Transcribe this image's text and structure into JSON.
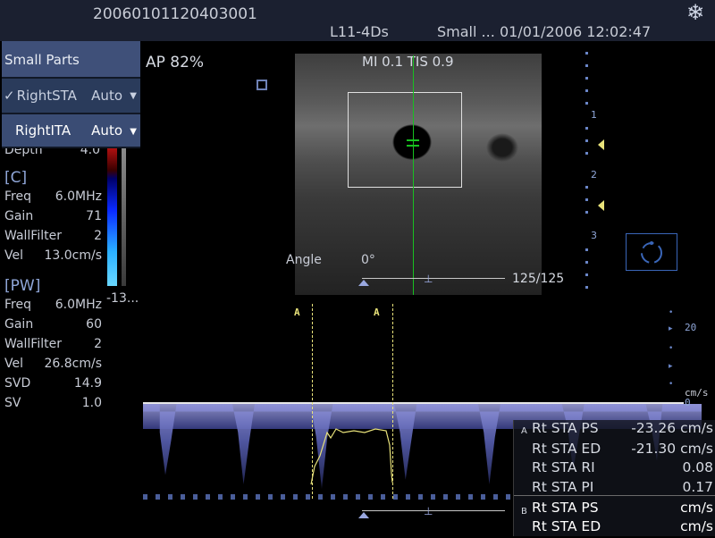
{
  "header": {
    "patient_id": "20060101120403001",
    "probe": "L11-4Ds",
    "preset": "Small ...",
    "datetime": "01/01/2006 12:02:47"
  },
  "menu": {
    "items": [
      {
        "label": "Small Parts",
        "value": "",
        "checked": false
      },
      {
        "label": "RightSTA",
        "value": "Auto",
        "checked": true
      },
      {
        "label": "RightITA",
        "value": "Auto",
        "checked": false
      }
    ]
  },
  "image_info": {
    "ap": "AP  82%",
    "mi_tis": "MI 0.1  TIS 0.9",
    "angle_label": "Angle",
    "angle_value": "0°",
    "frame_counter": "125/125"
  },
  "depth": {
    "label": "Depth",
    "value": "4.0",
    "scale": [
      "1",
      "2",
      "3"
    ]
  },
  "color_params": {
    "title": "[C]",
    "rows": [
      {
        "label": "Freq",
        "value": "6.0MHz"
      },
      {
        "label": "Gain",
        "value": "71"
      },
      {
        "label": "WallFilter",
        "value": "2"
      },
      {
        "label": "Vel",
        "value": "13.0cm/s"
      }
    ],
    "colorbar_min": "-13..."
  },
  "pw_params": {
    "title": "[PW]",
    "rows": [
      {
        "label": "Freq",
        "value": "6.0MHz"
      },
      {
        "label": "Gain",
        "value": "60"
      },
      {
        "label": "WallFilter",
        "value": "2"
      },
      {
        "label": "Vel",
        "value": "26.8cm/s"
      },
      {
        "label": "SVD",
        "value": "14.9"
      },
      {
        "label": "SV",
        "value": "1.0"
      }
    ]
  },
  "doppler": {
    "marker_a1": "A",
    "marker_a2": "A",
    "scale_top": "20",
    "unit": "cm/s",
    "scale_zero": "0"
  },
  "measurements": {
    "group_a_tag": "A",
    "group_b_tag": "B",
    "rows": [
      {
        "label": "Rt STA PS",
        "value": "-23.26 cm/s"
      },
      {
        "label": "Rt STA ED",
        "value": "-21.30 cm/s"
      },
      {
        "label": "Rt STA RI",
        "value": "0.08"
      },
      {
        "label": "Rt STA PI",
        "value": "0.17"
      },
      {
        "label": "Rt STA PS",
        "value": "cm/s"
      },
      {
        "label": "Rt STA ED",
        "value": "cm/s"
      }
    ]
  },
  "colors": {
    "accent_blue": "#8fa6d8",
    "doppler_gate": "#18c020",
    "marker_yellow": "#e8e27a"
  }
}
